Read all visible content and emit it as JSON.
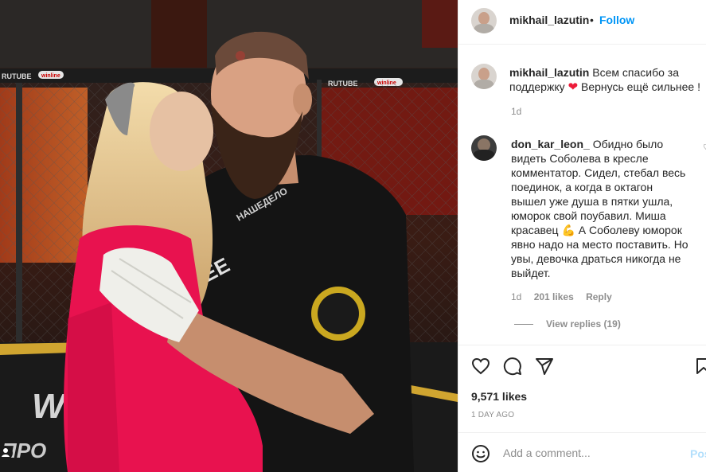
{
  "post": {
    "username": "mikhail_lazutin",
    "dot": "•",
    "follow_label": "Follow"
  },
  "caption": {
    "username": "mikhail_lazutin",
    "text_before_emoji": "Всем спасибо за поддержку",
    "emoji": "❤",
    "text_after_emoji": "Вернусь ещё сильнее !",
    "time": "1d"
  },
  "comment": {
    "username": "don_kar_leon_",
    "text_before_emoji": "Обидно было видеть Соболева в кресле комментатор. Сидел, стебал весь поединок, а когда в октагон вышел уже душа в пятки ушла, юморок свой поубавил. Миша красавец",
    "emoji": "💪",
    "text_after_emoji": "А Соболеву юморок явно надо на место поставить. Но увы, девочка драться никогда не выйдет.",
    "time": "1d",
    "likes": "201 likes",
    "reply_label": "Reply",
    "view_replies": "View replies (19)"
  },
  "actions": {
    "icons": [
      "heart-icon",
      "comment-icon",
      "share-icon",
      "bookmark-icon"
    ],
    "likes": "9,571 likes",
    "time": "1 DAY AGO"
  },
  "add_comment": {
    "placeholder": "Add a comment...",
    "post_label": "Post"
  },
  "photo": {
    "banner_texts": [
      "RUTUBE",
      "winline",
      "RUTUBE",
      "winline"
    ],
    "shirt_print": "НАШЕДЕЛО",
    "floor_logo": "WIN",
    "floor_text": "ПРО"
  },
  "colors": {
    "accent": "#0095f6",
    "post_disabled": "#b2dffc",
    "sweater": "#e8124f",
    "muted": "#8e8e8e"
  }
}
